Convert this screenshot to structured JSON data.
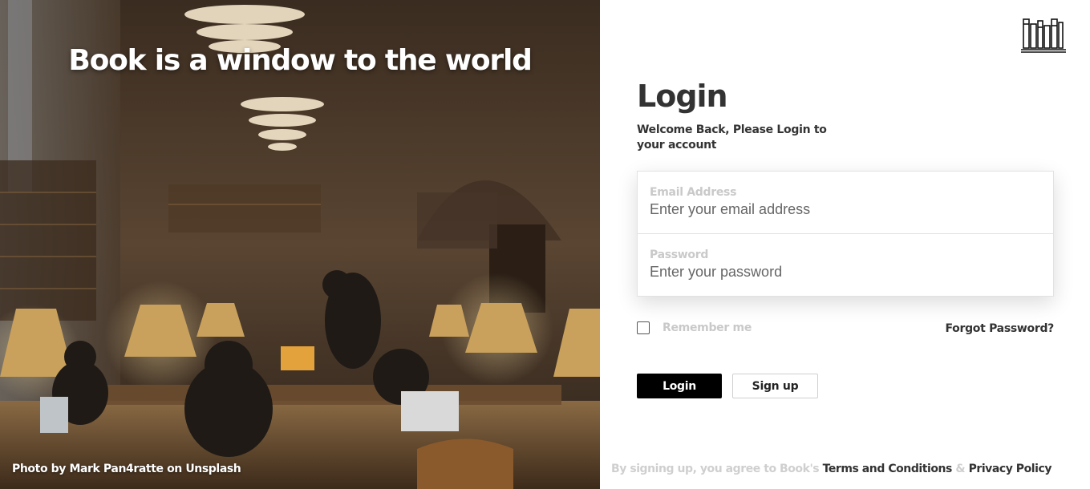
{
  "hero": {
    "title": "Book is a window to the world",
    "credit": "Photo by Mark Pan4ratte on Unsplash"
  },
  "logo": {
    "icon": "books-shelf-icon"
  },
  "login": {
    "title": "Login",
    "subtitle": "Welcome Back, Please Login to your account"
  },
  "form": {
    "email": {
      "label": "Email Address",
      "placeholder": "Enter your email address",
      "value": ""
    },
    "password": {
      "label": "Password",
      "placeholder": "Enter your password",
      "value": ""
    }
  },
  "options": {
    "remember_label": "Remember me",
    "remember_checked": false,
    "forgot_label": "Forgot Password?"
  },
  "buttons": {
    "login_label": "Login",
    "signup_label": "Sign up"
  },
  "footer": {
    "prefix": "By signing up, you agree to Book's",
    "terms": "Terms and Conditions",
    "amp": "&",
    "privacy": "Privacy Policy"
  },
  "colors": {
    "primary": "#000000",
    "text_dark": "#333333",
    "muted_label": "#c9c9c9",
    "placeholder": "#666666"
  }
}
